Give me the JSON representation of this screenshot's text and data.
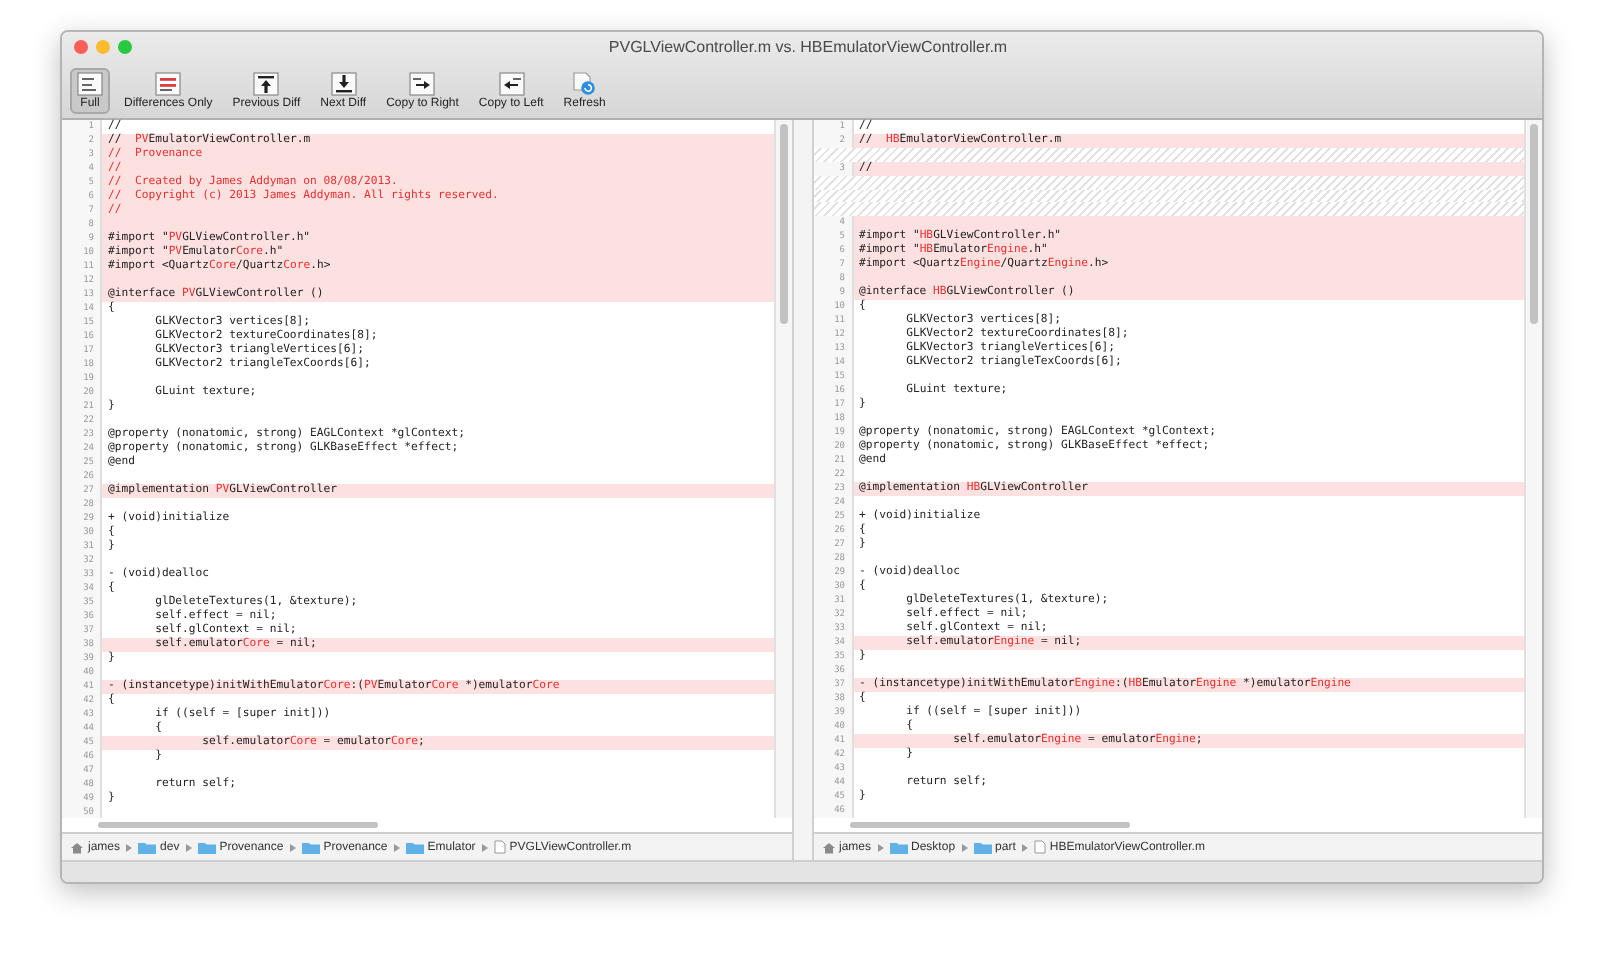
{
  "window": {
    "title": "PVGLViewController.m vs. HBEmulatorViewController.m"
  },
  "toolbar": [
    {
      "label": "Full",
      "selected": true
    },
    {
      "label": "Differences Only",
      "selected": false
    },
    {
      "label": "Previous Diff",
      "selected": false
    },
    {
      "label": "Next Diff",
      "selected": false
    },
    {
      "label": "Copy to Right",
      "selected": false
    },
    {
      "label": "Copy to Left",
      "selected": false
    },
    {
      "label": "Refresh",
      "selected": false
    }
  ],
  "panes": [
    {
      "lines": [
        {
          "kind": "code",
          "n": "1",
          "changed": false,
          "text": "//"
        },
        {
          "kind": "code",
          "n": "2",
          "changed": true,
          "segments": [
            {
              "text": "//  ",
              "changed": false
            },
            {
              "text": "PV",
              "changed": true
            },
            {
              "text": "EmulatorViewController.m",
              "changed": false
            }
          ]
        },
        {
          "kind": "code",
          "n": "3",
          "changed": true,
          "segments": [
            {
              "text": "//  Provenance",
              "changed": true
            }
          ]
        },
        {
          "kind": "code",
          "n": "4",
          "changed": true,
          "segments": [
            {
              "text": "//",
              "changed": true
            }
          ]
        },
        {
          "kind": "code",
          "n": "5",
          "changed": true,
          "segments": [
            {
              "text": "//  Created by James Addyman on 08/08/2013.",
              "changed": true
            }
          ]
        },
        {
          "kind": "code",
          "n": "6",
          "changed": true,
          "segments": [
            {
              "text": "//  Copyright (c) 2013 James Addyman. All rights reserved.",
              "changed": true
            }
          ]
        },
        {
          "kind": "code",
          "n": "7",
          "changed": true,
          "segments": [
            {
              "text": "//",
              "changed": true
            }
          ]
        },
        {
          "kind": "code",
          "n": "8",
          "changed": true
        },
        {
          "kind": "code",
          "n": "9",
          "changed": true,
          "segments": [
            {
              "text": "#import \"",
              "changed": false
            },
            {
              "text": "PV",
              "changed": true
            },
            {
              "text": "GLViewController.h\"",
              "changed": false
            }
          ]
        },
        {
          "kind": "code",
          "n": "10",
          "changed": true,
          "segments": [
            {
              "text": "#import \"",
              "changed": false
            },
            {
              "text": "PV",
              "changed": true
            },
            {
              "text": "Emulator",
              "changed": false
            },
            {
              "text": "Core",
              "changed": true
            },
            {
              "text": ".h\"",
              "changed": false
            }
          ]
        },
        {
          "kind": "code",
          "n": "11",
          "changed": true,
          "segments": [
            {
              "text": "#import <Quartz",
              "changed": false
            },
            {
              "text": "Core",
              "changed": true
            },
            {
              "text": "/Quartz",
              "changed": false
            },
            {
              "text": "Core",
              "changed": true
            },
            {
              "text": ".h>",
              "changed": false
            }
          ]
        },
        {
          "kind": "code",
          "n": "12",
          "changed": true
        },
        {
          "kind": "code",
          "n": "13",
          "changed": true,
          "segments": [
            {
              "text": "@interface ",
              "changed": false
            },
            {
              "text": "PV",
              "changed": true
            },
            {
              "text": "GLViewController ()",
              "changed": false
            }
          ]
        },
        {
          "kind": "code",
          "n": "14",
          "changed": false,
          "text": "{"
        },
        {
          "kind": "code",
          "n": "15",
          "changed": false,
          "text": "\tGLKVector3 vertices[8];"
        },
        {
          "kind": "code",
          "n": "16",
          "changed": false,
          "text": "\tGLKVector2 textureCoordinates[8];"
        },
        {
          "kind": "code",
          "n": "17",
          "changed": false,
          "text": "\tGLKVector3 triangleVertices[6];"
        },
        {
          "kind": "code",
          "n": "18",
          "changed": false,
          "text": "\tGLKVector2 triangleTexCoords[6];"
        },
        {
          "kind": "code",
          "n": "19",
          "changed": false
        },
        {
          "kind": "code",
          "n": "20",
          "changed": false,
          "text": "\tGLuint texture;"
        },
        {
          "kind": "code",
          "n": "21",
          "changed": false,
          "text": "}"
        },
        {
          "kind": "code",
          "n": "22",
          "changed": false
        },
        {
          "kind": "code",
          "n": "23",
          "changed": false,
          "text": "@property (nonatomic, strong) EAGLContext *glContext;"
        },
        {
          "kind": "code",
          "n": "24",
          "changed": false,
          "text": "@property (nonatomic, strong) GLKBaseEffect *effect;"
        },
        {
          "kind": "code",
          "n": "25",
          "changed": false,
          "text": "@end"
        },
        {
          "kind": "code",
          "n": "26",
          "changed": false
        },
        {
          "kind": "code",
          "n": "27",
          "changed": true,
          "segments": [
            {
              "text": "@implementation ",
              "changed": false
            },
            {
              "text": "PV",
              "changed": true
            },
            {
              "text": "GLViewController",
              "changed": false
            }
          ]
        },
        {
          "kind": "code",
          "n": "28",
          "changed": false
        },
        {
          "kind": "code",
          "n": "29",
          "changed": false,
          "text": "+ (void)initialize"
        },
        {
          "kind": "code",
          "n": "30",
          "changed": false,
          "text": "{"
        },
        {
          "kind": "code",
          "n": "31",
          "changed": false,
          "text": "}"
        },
        {
          "kind": "code",
          "n": "32",
          "changed": false
        },
        {
          "kind": "code",
          "n": "33",
          "changed": false,
          "text": "- (void)dealloc"
        },
        {
          "kind": "code",
          "n": "34",
          "changed": false,
          "text": "{"
        },
        {
          "kind": "code",
          "n": "35",
          "changed": false,
          "text": "\tglDeleteTextures(1, &texture);"
        },
        {
          "kind": "code",
          "n": "36",
          "changed": false,
          "text": "\tself.effect = nil;"
        },
        {
          "kind": "code",
          "n": "37",
          "changed": false,
          "text": "\tself.glContext = nil;"
        },
        {
          "kind": "code",
          "n": "38",
          "changed": true,
          "segments": [
            {
              "text": "\tself.emulator",
              "changed": false
            },
            {
              "text": "Core",
              "changed": true
            },
            {
              "text": " = nil;",
              "changed": false
            }
          ]
        },
        {
          "kind": "code",
          "n": "39",
          "changed": false,
          "text": "}"
        },
        {
          "kind": "code",
          "n": "40",
          "changed": false
        },
        {
          "kind": "code",
          "n": "41",
          "changed": true,
          "segments": [
            {
              "text": "- (instancetype)initWithEmulator",
              "changed": false
            },
            {
              "text": "Core",
              "changed": true
            },
            {
              "text": ":(",
              "changed": false
            },
            {
              "text": "PV",
              "changed": true
            },
            {
              "text": "Emulator",
              "changed": false
            },
            {
              "text": "Core",
              "changed": true
            },
            {
              "text": " *)emulator",
              "changed": false
            },
            {
              "text": "Core",
              "changed": true
            }
          ]
        },
        {
          "kind": "code",
          "n": "42",
          "changed": false,
          "text": "{"
        },
        {
          "kind": "code",
          "n": "43",
          "changed": false,
          "text": "\tif ((self = [super init]))"
        },
        {
          "kind": "code",
          "n": "44",
          "changed": false,
          "text": "\t{"
        },
        {
          "kind": "code",
          "n": "45",
          "changed": true,
          "segments": [
            {
              "text": "\t\tself.emulator",
              "changed": false
            },
            {
              "text": "Core",
              "changed": true
            },
            {
              "text": " = emulator",
              "changed": false
            },
            {
              "text": "Core",
              "changed": true
            },
            {
              "text": ";",
              "changed": false
            }
          ]
        },
        {
          "kind": "code",
          "n": "46",
          "changed": false,
          "text": "\t}"
        },
        {
          "kind": "code",
          "n": "47",
          "changed": false
        },
        {
          "kind": "code",
          "n": "48",
          "changed": false,
          "text": "\treturn self;"
        },
        {
          "kind": "code",
          "n": "49",
          "changed": false,
          "text": "}"
        },
        {
          "kind": "code",
          "n": "50",
          "changed": false
        }
      ],
      "path": [
        {
          "kind": "home",
          "label": "james"
        },
        {
          "kind": "folder",
          "label": "dev"
        },
        {
          "kind": "folder",
          "label": "Provenance"
        },
        {
          "kind": "folder",
          "label": "Provenance"
        },
        {
          "kind": "folder",
          "label": "Emulator"
        },
        {
          "kind": "file",
          "label": "PVGLViewController.m"
        }
      ]
    },
    {
      "lines": [
        {
          "kind": "code",
          "n": "1",
          "changed": false,
          "text": "//"
        },
        {
          "kind": "code",
          "n": "2",
          "changed": true,
          "segments": [
            {
              "text": "//  ",
              "changed": false
            },
            {
              "text": "HB",
              "changed": true
            },
            {
              "text": "EmulatorViewController.m",
              "changed": false
            }
          ]
        },
        {
          "kind": "filler"
        },
        {
          "kind": "code",
          "n": "3",
          "changed": true,
          "text": "//"
        },
        {
          "kind": "filler"
        },
        {
          "kind": "filler"
        },
        {
          "kind": "filler"
        },
        {
          "kind": "code",
          "n": "4",
          "changed": true
        },
        {
          "kind": "code",
          "n": "5",
          "changed": true,
          "segments": [
            {
              "text": "#import \"",
              "changed": false
            },
            {
              "text": "HB",
              "changed": true
            },
            {
              "text": "GLViewController.h\"",
              "changed": false
            }
          ]
        },
        {
          "kind": "code",
          "n": "6",
          "changed": true,
          "segments": [
            {
              "text": "#import \"",
              "changed": false
            },
            {
              "text": "HB",
              "changed": true
            },
            {
              "text": "Emulator",
              "changed": false
            },
            {
              "text": "Engine",
              "changed": true
            },
            {
              "text": ".h\"",
              "changed": false
            }
          ]
        },
        {
          "kind": "code",
          "n": "7",
          "changed": true,
          "segments": [
            {
              "text": "#import <Quartz",
              "changed": false
            },
            {
              "text": "Engine",
              "changed": true
            },
            {
              "text": "/Quartz",
              "changed": false
            },
            {
              "text": "Engine",
              "changed": true
            },
            {
              "text": ".h>",
              "changed": false
            }
          ]
        },
        {
          "kind": "code",
          "n": "8",
          "changed": true
        },
        {
          "kind": "code",
          "n": "9",
          "changed": true,
          "segments": [
            {
              "text": "@interface ",
              "changed": false
            },
            {
              "text": "HB",
              "changed": true
            },
            {
              "text": "GLViewController ()",
              "changed": false
            }
          ]
        },
        {
          "kind": "code",
          "n": "10",
          "changed": false,
          "text": "{"
        },
        {
          "kind": "code",
          "n": "11",
          "changed": false,
          "text": "\tGLKVector3 vertices[8];"
        },
        {
          "kind": "code",
          "n": "12",
          "changed": false,
          "text": "\tGLKVector2 textureCoordinates[8];"
        },
        {
          "kind": "code",
          "n": "13",
          "changed": false,
          "text": "\tGLKVector3 triangleVertices[6];"
        },
        {
          "kind": "code",
          "n": "14",
          "changed": false,
          "text": "\tGLKVector2 triangleTexCoords[6];"
        },
        {
          "kind": "code",
          "n": "15",
          "changed": false
        },
        {
          "kind": "code",
          "n": "16",
          "changed": false,
          "text": "\tGLuint texture;"
        },
        {
          "kind": "code",
          "n": "17",
          "changed": false,
          "text": "}"
        },
        {
          "kind": "code",
          "n": "18",
          "changed": false
        },
        {
          "kind": "code",
          "n": "19",
          "changed": false,
          "text": "@property (nonatomic, strong) EAGLContext *glContext;"
        },
        {
          "kind": "code",
          "n": "20",
          "changed": false,
          "text": "@property (nonatomic, strong) GLKBaseEffect *effect;"
        },
        {
          "kind": "code",
          "n": "21",
          "changed": false,
          "text": "@end"
        },
        {
          "kind": "code",
          "n": "22",
          "changed": false
        },
        {
          "kind": "code",
          "n": "23",
          "changed": true,
          "segments": [
            {
              "text": "@implementation ",
              "changed": false
            },
            {
              "text": "HB",
              "changed": true
            },
            {
              "text": "GLViewController",
              "changed": false
            }
          ]
        },
        {
          "kind": "code",
          "n": "24",
          "changed": false
        },
        {
          "kind": "code",
          "n": "25",
          "changed": false,
          "text": "+ (void)initialize"
        },
        {
          "kind": "code",
          "n": "26",
          "changed": false,
          "text": "{"
        },
        {
          "kind": "code",
          "n": "27",
          "changed": false,
          "text": "}"
        },
        {
          "kind": "code",
          "n": "28",
          "changed": false
        },
        {
          "kind": "code",
          "n": "29",
          "changed": false,
          "text": "- (void)dealloc"
        },
        {
          "kind": "code",
          "n": "30",
          "changed": false,
          "text": "{"
        },
        {
          "kind": "code",
          "n": "31",
          "changed": false,
          "text": "\tglDeleteTextures(1, &texture);"
        },
        {
          "kind": "code",
          "n": "32",
          "changed": false,
          "text": "\tself.effect = nil;"
        },
        {
          "kind": "code",
          "n": "33",
          "changed": false,
          "text": "\tself.glContext = nil;"
        },
        {
          "kind": "code",
          "n": "34",
          "changed": true,
          "segments": [
            {
              "text": "\tself.emulator",
              "changed": false
            },
            {
              "text": "Engine",
              "changed": true
            },
            {
              "text": " = nil;",
              "changed": false
            }
          ]
        },
        {
          "kind": "code",
          "n": "35",
          "changed": false,
          "text": "}"
        },
        {
          "kind": "code",
          "n": "36",
          "changed": false
        },
        {
          "kind": "code",
          "n": "37",
          "changed": true,
          "segments": [
            {
              "text": "- (instancetype)initWithEmulator",
              "changed": false
            },
            {
              "text": "Engine",
              "changed": true
            },
            {
              "text": ":(",
              "changed": false
            },
            {
              "text": "HB",
              "changed": true
            },
            {
              "text": "Emulator",
              "changed": false
            },
            {
              "text": "Engine",
              "changed": true
            },
            {
              "text": " *)emulator",
              "changed": false
            },
            {
              "text": "Engine",
              "changed": true
            }
          ]
        },
        {
          "kind": "code",
          "n": "38",
          "changed": false,
          "text": "{"
        },
        {
          "kind": "code",
          "n": "39",
          "changed": false,
          "text": "\tif ((self = [super init]))"
        },
        {
          "kind": "code",
          "n": "40",
          "changed": false,
          "text": "\t{"
        },
        {
          "kind": "code",
          "n": "41",
          "changed": true,
          "segments": [
            {
              "text": "\t\tself.emulator",
              "changed": false
            },
            {
              "text": "Engine",
              "changed": true
            },
            {
              "text": " = emulator",
              "changed": false
            },
            {
              "text": "Engine",
              "changed": true
            },
            {
              "text": ";",
              "changed": false
            }
          ]
        },
        {
          "kind": "code",
          "n": "42",
          "changed": false,
          "text": "\t}"
        },
        {
          "kind": "code",
          "n": "43",
          "changed": false
        },
        {
          "kind": "code",
          "n": "44",
          "changed": false,
          "text": "\treturn self;"
        },
        {
          "kind": "code",
          "n": "45",
          "changed": false,
          "text": "}"
        },
        {
          "kind": "code",
          "n": "46",
          "changed": false
        }
      ],
      "path": [
        {
          "kind": "home",
          "label": "james"
        },
        {
          "kind": "folder",
          "label": "Desktop"
        },
        {
          "kind": "folder",
          "label": "part"
        },
        {
          "kind": "file",
          "label": "HBEmulatorViewController.m"
        }
      ]
    }
  ]
}
